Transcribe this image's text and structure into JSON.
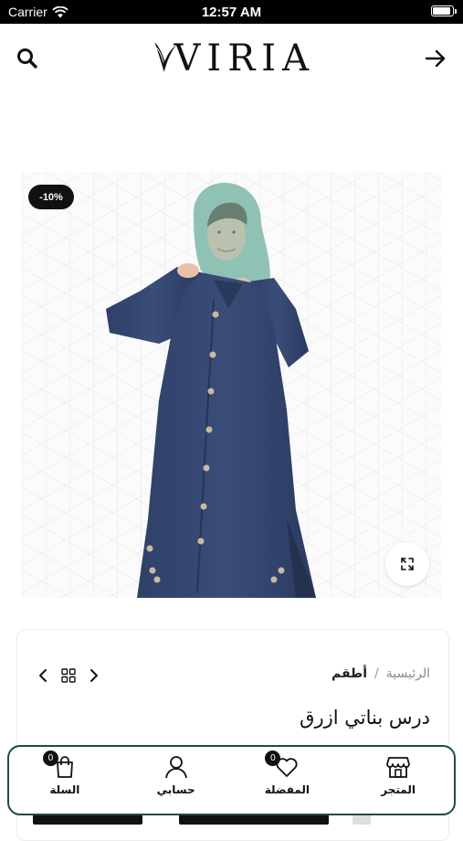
{
  "status_bar": {
    "carrier": "Carrier",
    "time": "12:57 AM",
    "battery_level": 0.95
  },
  "header": {
    "logo_text": "VIRIA"
  },
  "product": {
    "discount_badge": "-10%",
    "breadcrumb": {
      "home": "الرئيسية",
      "separator": "/",
      "current": "أطقم"
    },
    "title": "درس بناتي ازرق"
  },
  "bottom_nav": {
    "items": [
      {
        "label": "السلة",
        "icon": "shopping-bag-icon",
        "badge": "0"
      },
      {
        "label": "حسابي",
        "icon": "user-icon"
      },
      {
        "label": "المفضلة",
        "icon": "heart-icon",
        "badge": "0"
      },
      {
        "label": "المتجر",
        "icon": "store-icon"
      }
    ]
  },
  "colors": {
    "accent": "#1e4f3a",
    "garment": "#34466e",
    "hijab": "#8fc2b5",
    "badge_bg": "#111111"
  }
}
